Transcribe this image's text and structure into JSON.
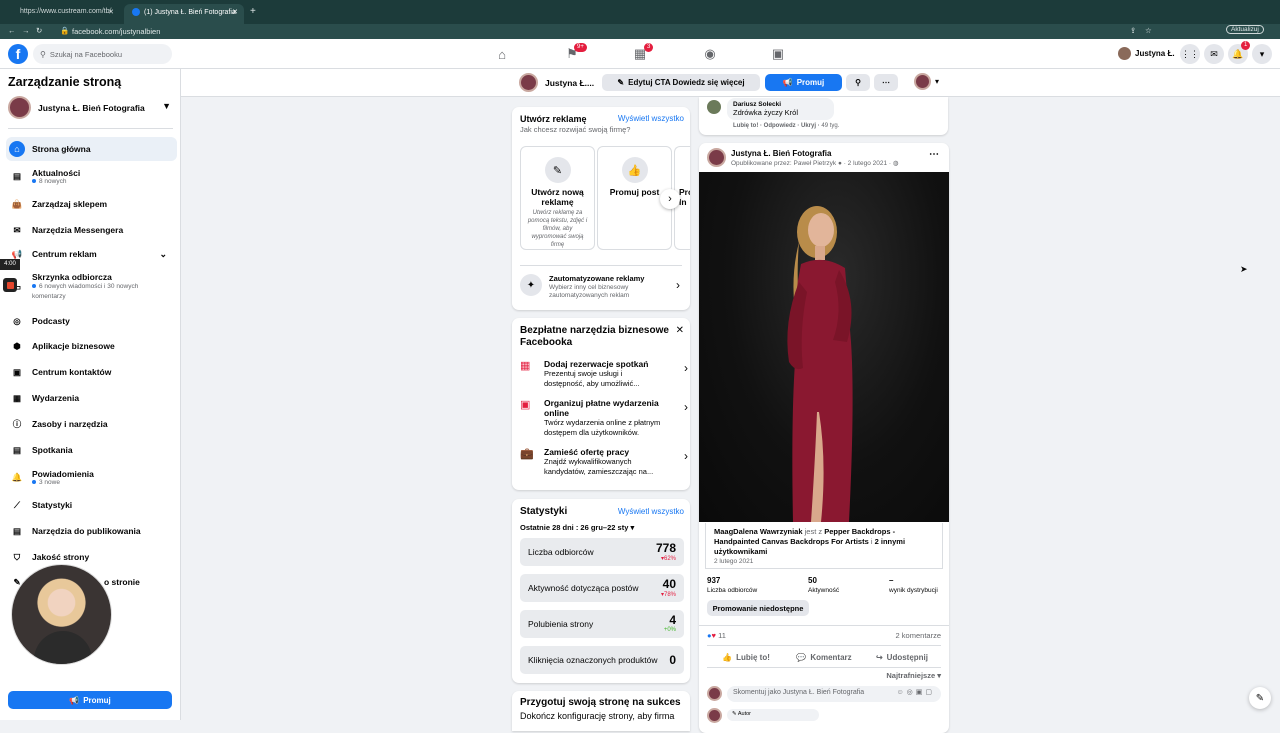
{
  "browser": {
    "tabs": [
      "https://www.custream.com/tb/",
      "(1) Justyna Ł. Bień Fotografia"
    ],
    "url": "facebook.com/justynalbien",
    "update_label": "Aktualizuj"
  },
  "fb_header": {
    "search_placeholder": "Szukaj na Facebooku",
    "user_name": "Justyna Ł.",
    "badges": {
      "flag": "9+",
      "store": "3",
      "notif": "1"
    }
  },
  "sidebar": {
    "title": "Zarządzanie stroną",
    "page_name": "Justyna Ł. Bień Fotografia",
    "items": [
      {
        "label": "Strona główna",
        "sub": ""
      },
      {
        "label": "Aktualności",
        "sub": "8 nowych"
      },
      {
        "label": "Zarządzaj sklepem",
        "sub": ""
      },
      {
        "label": "Narzędzia Messengera",
        "sub": ""
      },
      {
        "label": "Centrum reklam",
        "sub": ""
      },
      {
        "label": "Skrzynka odbiorcza",
        "sub": "6 nowych wiadomości i 30 nowych komentarzy"
      },
      {
        "label": "Podcasty",
        "sub": ""
      },
      {
        "label": "Aplikacje biznesowe",
        "sub": ""
      },
      {
        "label": "Centrum kontaktów",
        "sub": ""
      },
      {
        "label": "Wydarzenia",
        "sub": ""
      },
      {
        "label": "Zasoby i narzędzia",
        "sub": ""
      },
      {
        "label": "Spotkania",
        "sub": ""
      },
      {
        "label": "Powiadomienia",
        "sub": "3 nowe"
      },
      {
        "label": "Statystyki",
        "sub": ""
      },
      {
        "label": "Narzędzia do publikowania",
        "sub": ""
      },
      {
        "label": "Jakość strony",
        "sub": ""
      },
      {
        "label": "o stronie",
        "sub": ""
      }
    ],
    "promote": "Promuj",
    "timer": "4:00"
  },
  "page_header": {
    "name": "Justyna Ł....",
    "edit_cta": "Edytuj CTA Dowiedz się więcej",
    "promote": "Promuj"
  },
  "create_ad": {
    "title": "Utwórz reklamę",
    "see_all": "Wyświetl wszystko",
    "subtitle": "Jak chcesz rozwijać swoją firmę?",
    "options": [
      {
        "title": "Utwórz nową reklamę",
        "desc": "Utwórz reklamę za pomocą tekstu, zdjęć i filmów, aby wypromować swoją firmę"
      },
      {
        "title": "Promuj post",
        "desc": ""
      },
      {
        "title": "Pro In",
        "desc": ""
      }
    ],
    "auto_title": "Zautomatyzowane reklamy",
    "auto_desc": "Wybierz inny cel biznesowy zautomatyzowanych reklam"
  },
  "tools": {
    "title": "Bezpłatne narzędzia biznesowe Facebooka",
    "items": [
      {
        "title": "Dodaj rezerwacje spotkań",
        "desc": "Prezentuj swoje usługi i dostępność, aby umożliwić..."
      },
      {
        "title": "Organizuj płatne wydarzenia online",
        "desc": "Twórz wydarzenia online z płatnym dostępem dla użytkowników."
      },
      {
        "title": "Zamieść ofertę pracy",
        "desc": "Znajdź wykwalifikowanych kandydatów, zamieszczając na..."
      }
    ]
  },
  "stats": {
    "title": "Statystyki",
    "see_all": "Wyświetl wszystko",
    "period": "Ostatnie 28 dni : 26 gru–22 sty",
    "rows": [
      {
        "label": "Liczba odbiorców",
        "value": "778",
        "change": "▾62%",
        "color": "#e41e3f"
      },
      {
        "label": "Aktywność dotycząca postów",
        "value": "40",
        "change": "▾78%",
        "color": "#e41e3f"
      },
      {
        "label": "Polubienia strony",
        "value": "4",
        "change": "+0%",
        "color": "#42b72a"
      },
      {
        "label": "Kliknięcia oznaczonych produktów",
        "value": "0",
        "change": "",
        "color": "#65676b"
      }
    ]
  },
  "prepare": {
    "title": "Przygotuj swoją stronę na sukces",
    "desc": "Dokończ konfigurację strony, aby firma"
  },
  "comment_top": {
    "author": "Dariusz Solecki",
    "text": "Zdrówka życzy Król",
    "actions": [
      "Lubię to!",
      "Odpowiedz",
      "Ukryj",
      "49 tyg."
    ]
  },
  "post": {
    "author": "Justyna Ł. Bień Fotografia",
    "meta": "Opublikowane przez: Paweł Pietrzyk",
    "date": "2 lutego 2021",
    "tag_name": "MaagDalena Wawrzyniak",
    "tag_with": "jest z",
    "tag_page": "Pepper Backdrops - Handpainted Canvas Backdrops For Artists",
    "tag_and": "i",
    "tag_others": "2 innymi użytkownikami",
    "tag_date": "2 lutego 2021",
    "metrics": [
      {
        "value": "937",
        "label": "Liczba odbiorców"
      },
      {
        "value": "50",
        "label": "Aktywność"
      },
      {
        "value": "–",
        "label": "wynik dystrybucji"
      }
    ],
    "promo_unavailable": "Promowanie niedostępne",
    "reactions": "11",
    "comments_count": "2 komentarze",
    "actions": [
      "Lubię to!",
      "Komentarz",
      "Udostępnij"
    ],
    "sort": "Najtrafniejsze",
    "comment_placeholder": "Skomentuj jako Justyna Ł. Bień Fotografia",
    "author_badge": "Autor"
  },
  "colors": {
    "accent": "#1877f2",
    "dress": "#8a1830"
  }
}
